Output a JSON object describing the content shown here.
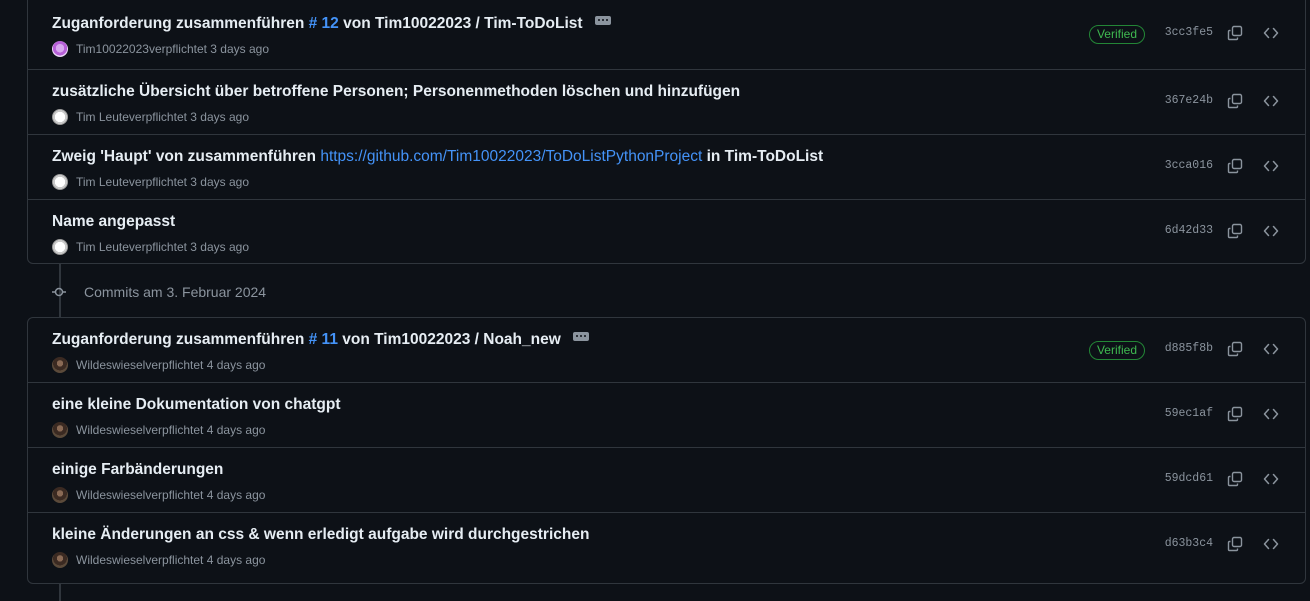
{
  "groups": [
    {
      "commits": [
        {
          "title_prefix": "Zuganforderung zusammenführen ",
          "pr_link": "# 12",
          "title_suffix": " von Tim10022023 / Tim-ToDoList",
          "author": "Tim10022023",
          "meta_text": " verpflichtet 3 days ago",
          "verified": "Verified",
          "sha": "3cc3fe5"
        },
        {
          "title": "zusätzliche Übersicht über betroffene Personen; Personenmethoden löschen und hinzufügen",
          "author": "Tim Leute",
          "meta_text": " verpflichtet 3 days ago",
          "sha": "367e24b"
        },
        {
          "title_prefix": "Zweig 'Haupt' von zusammenführen ",
          "link": "https://github.com/Tim10022023/ToDoListPythonProject",
          "title_suffix": " in Tim-ToDoList",
          "author": "Tim Leute",
          "meta_text": " verpflichtet 3 days ago",
          "sha": "3cca016"
        },
        {
          "title": "Name angepasst",
          "author": "Tim Leute",
          "meta_text": " verpflichtet 3 days ago",
          "sha": "6d42d33"
        }
      ]
    },
    {
      "day_label": "Commits am 3. Februar 2024",
      "commits": [
        {
          "title_prefix": "Zuganforderung zusammenführen ",
          "pr_link": "# 11",
          "title_suffix": " von Tim10022023 / Noah_new",
          "author": "Wildeswiesel",
          "meta_text": " verpflichtet 4 days ago",
          "verified": "Verified",
          "sha": "d885f8b"
        },
        {
          "title": "eine kleine Dokumentation von chatgpt",
          "author": "Wildeswiesel",
          "meta_text": " verpflichtet 4 days ago",
          "sha": "59ec1af"
        },
        {
          "title": "einige Farbänderungen",
          "author": "Wildeswiesel",
          "meta_text": " verpflichtet 4 days ago",
          "sha": "59dcd61"
        },
        {
          "title": "kleine Änderungen an css & wenn erledigt aufgabe wird durchgestrichen",
          "author": "Wildeswiesel",
          "meta_text": " verpflichtet 4 days ago",
          "sha": "d63b3c4"
        }
      ]
    }
  ],
  "colors": {
    "background": "#0d1117",
    "border": "#30363d",
    "text": "#e6edf3",
    "muted": "#8b949e",
    "link": "#4493f8",
    "verified": "#3fb950"
  },
  "icons": [
    "avatar",
    "ellipsis-icon",
    "copy-icon",
    "code-icon",
    "commit-node-icon"
  ]
}
